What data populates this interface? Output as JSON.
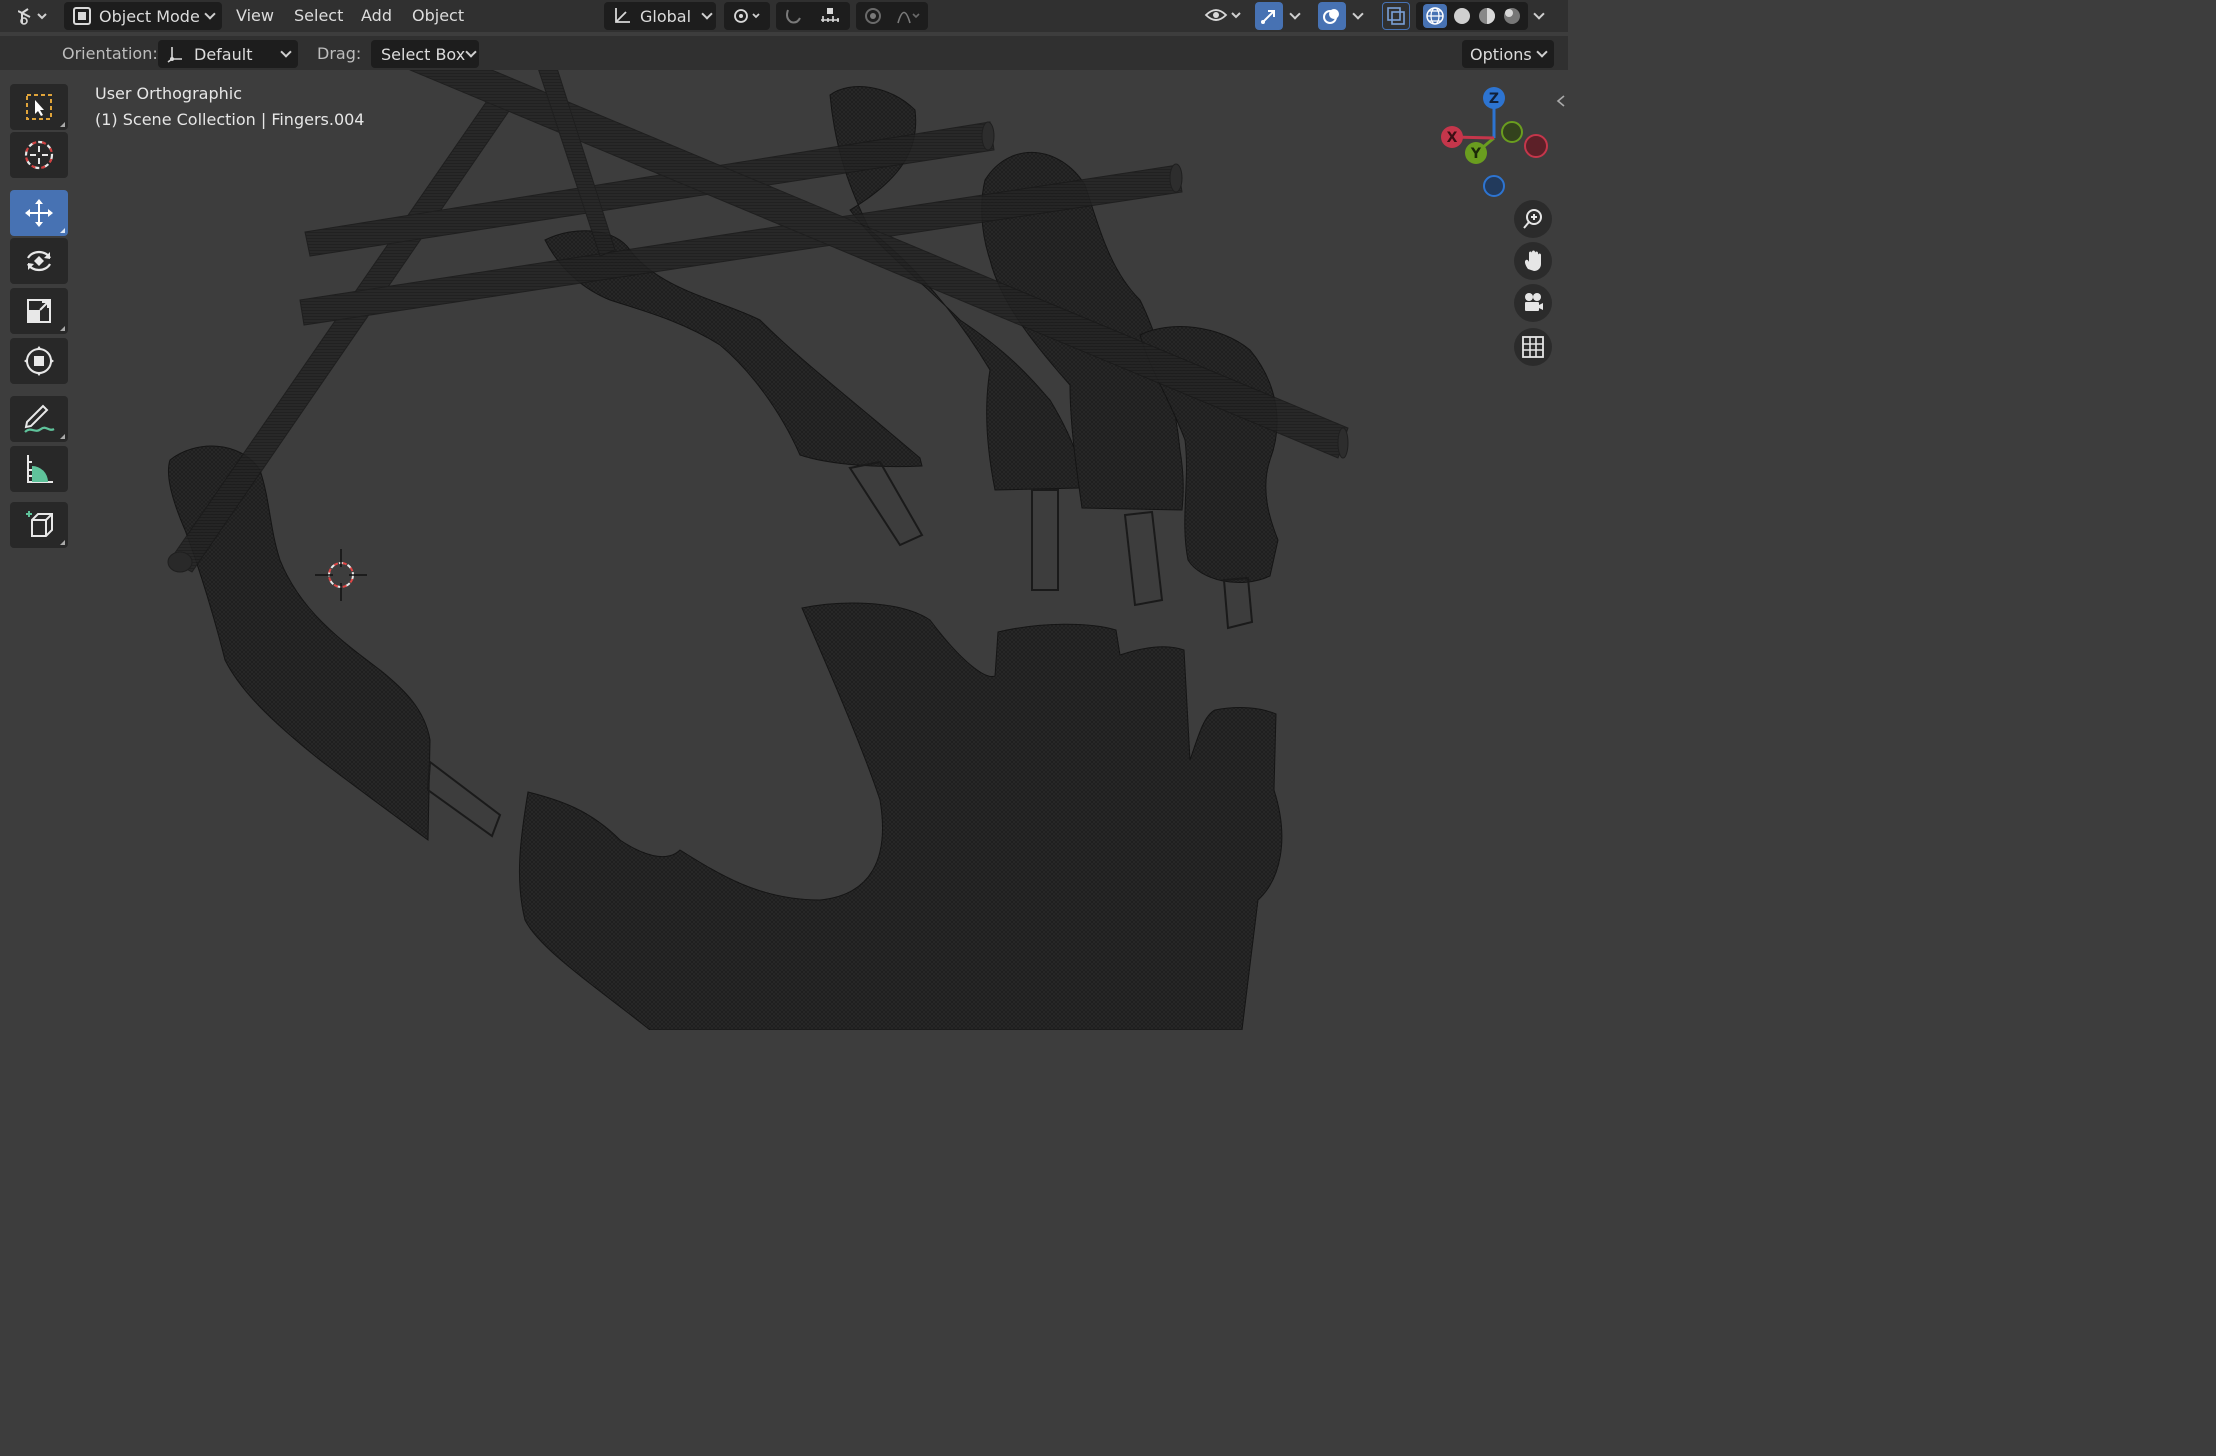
{
  "header": {
    "editor_type_icon": "editor-type-icon",
    "mode": "Object Mode",
    "menus": [
      "View",
      "Select",
      "Add",
      "Object"
    ],
    "transform_orientation": "Global",
    "right_icons": [
      "visibility-icon",
      "gizmo-icon",
      "overlay-icon",
      "xray-icon",
      "wireframe-shading-icon",
      "solid-shading-icon",
      "material-shading-icon",
      "rendered-shading-icon"
    ]
  },
  "tool_settings": {
    "orientation_label": "Orientation:",
    "orientation_value": "Default",
    "drag_label": "Drag:",
    "drag_value": "Select Box",
    "options_label": "Options"
  },
  "toolbar": {
    "tools": [
      {
        "name": "select-box-tool",
        "icon": "select-box-icon",
        "active": false
      },
      {
        "name": "cursor-tool",
        "icon": "cursor-icon",
        "active": false
      },
      {
        "name": "move-tool",
        "icon": "move-icon",
        "active": true
      },
      {
        "name": "rotate-tool",
        "icon": "rotate-icon",
        "active": false
      },
      {
        "name": "scale-tool",
        "icon": "scale-icon",
        "active": false
      },
      {
        "name": "transform-tool",
        "icon": "transform-icon",
        "active": false
      },
      {
        "name": "annotate-tool",
        "icon": "annotate-icon",
        "active": false
      },
      {
        "name": "measure-tool",
        "icon": "measure-icon",
        "active": false
      },
      {
        "name": "add-cube-tool",
        "icon": "add-cube-icon",
        "active": false
      }
    ]
  },
  "viewport": {
    "view_name": "User Orthographic",
    "collection_info": "(1) Scene Collection | Fingers.004"
  },
  "gizmo": {
    "x_label": "X",
    "y_label": "Y",
    "z_label": "Z",
    "colors": {
      "x": "#c5364b",
      "y": "#6a9d1f",
      "z": "#2d74d1"
    }
  },
  "colors": {
    "header_bg": "#303030",
    "viewport_bg": "#3d3d3d",
    "accent": "#4772b3",
    "mesh": "#1e1e1e"
  }
}
